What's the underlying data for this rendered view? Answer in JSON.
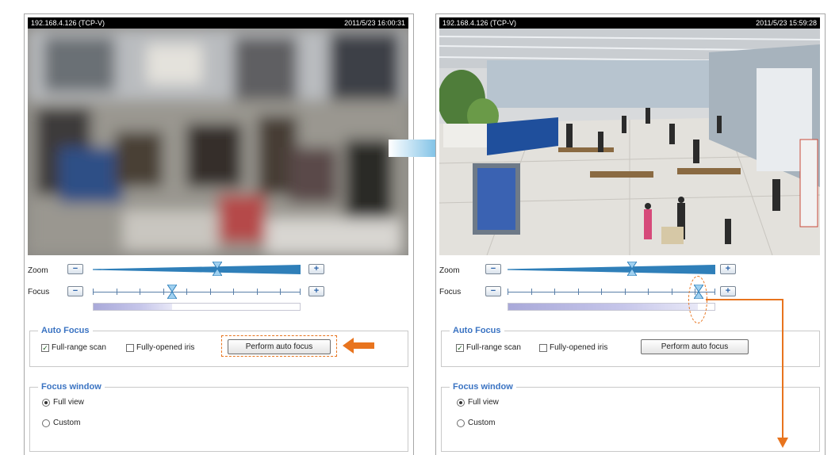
{
  "left": {
    "camera": {
      "ip_label": "192.168.4.126 (TCP-V)",
      "timestamp": "2011/5/23 16:00:31"
    },
    "zoom": {
      "label": "Zoom",
      "minus": "−",
      "plus": "+",
      "level": 0.6
    },
    "focus": {
      "label": "Focus",
      "minus": "−",
      "plus": "+",
      "level": 0.38,
      "progress": 0.38
    },
    "auto_focus": {
      "legend": "Auto Focus",
      "full_range_scan": {
        "label": "Full-range scan",
        "checked": true
      },
      "fully_opened_iris": {
        "label": "Fully-opened iris",
        "checked": false
      },
      "perform_button": "Perform auto focus"
    },
    "focus_window": {
      "legend": "Focus window",
      "full_view": "Full view",
      "custom": "Custom",
      "selected": "Full view"
    }
  },
  "right": {
    "camera": {
      "ip_label": "192.168.4.126 (TCP-V)",
      "timestamp": "2011/5/23 15:59:28"
    },
    "zoom": {
      "label": "Zoom",
      "minus": "−",
      "plus": "+",
      "level": 0.6
    },
    "focus": {
      "label": "Focus",
      "minus": "−",
      "plus": "+",
      "level": 0.92,
      "progress": 0.92
    },
    "auto_focus": {
      "legend": "Auto Focus",
      "full_range_scan": {
        "label": "Full-range scan",
        "checked": true
      },
      "fully_opened_iris": {
        "label": "Fully-opened iris",
        "checked": false
      },
      "perform_button": "Perform auto focus"
    },
    "focus_window": {
      "legend": "Focus window",
      "full_view": "Full view",
      "custom": "Custom",
      "selected": "Full view"
    }
  },
  "colors": {
    "accent_blue": "#2f7fb9",
    "legend_blue": "#3a73c2",
    "highlight_orange": "#e8741e",
    "arrow_blue": "#4aa8dc"
  },
  "icons": {
    "checkmark": "✓"
  }
}
